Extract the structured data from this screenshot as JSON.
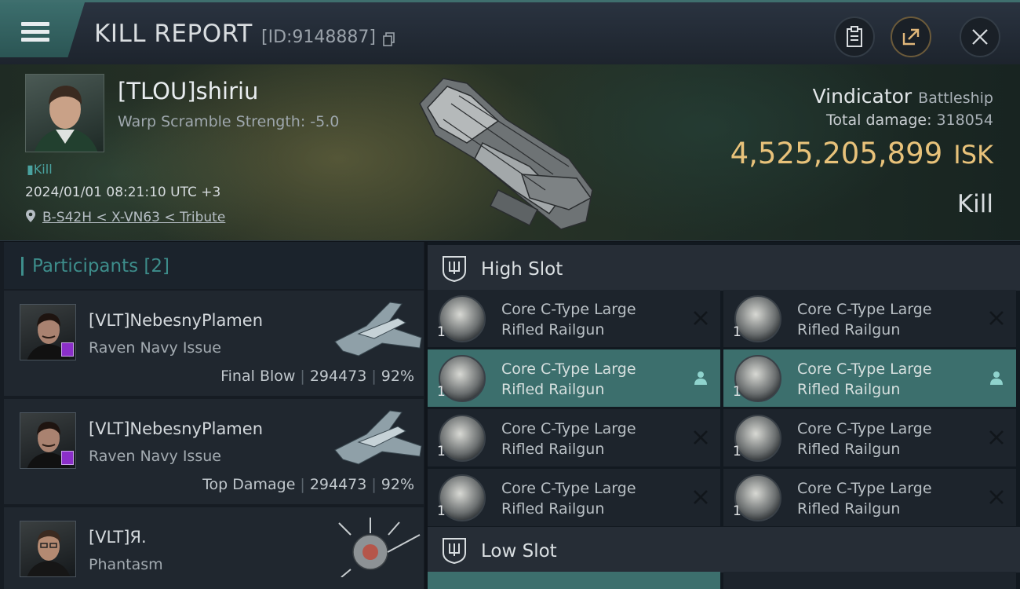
{
  "header": {
    "title": "KILL REPORT",
    "report_id": "[ID:9148887]",
    "icons": [
      "menu-icon",
      "copy-icon",
      "clipboard-icon",
      "share-icon",
      "close-icon"
    ]
  },
  "victim": {
    "name": "[TLOU]shiriu",
    "warp_scramble": "Warp Scramble Strength: -5.0",
    "tag": "Kill",
    "datetime": "2024/01/01 08:21:10 UTC +3",
    "location": "B-S42H < X-VN63 < Tribute"
  },
  "ship": {
    "name": "Vindicator",
    "class": "Battleship",
    "total_damage_label": "Total damage:",
    "total_damage_value": "318054",
    "isk_value": "4,525,205,899",
    "isk_currency": "ISK",
    "kill_label": "Kill"
  },
  "participants": {
    "title": "Participants",
    "count": "[2]",
    "items": [
      {
        "name": "[VLT]NebesnyPlamen",
        "ship": "Raven Navy Issue",
        "role": "Final Blow",
        "damage": "294473",
        "percent": "92%"
      },
      {
        "name": "[VLT]NebesnyPlamen",
        "ship": "Raven Navy Issue",
        "role": "Top Damage",
        "damage": "294473",
        "percent": "92%"
      },
      {
        "name": "[VLT]Я.",
        "ship": "Phantasm",
        "role": "",
        "damage": "",
        "percent": ""
      }
    ]
  },
  "fitting": {
    "high_slot": {
      "title": "High Slot",
      "modules": [
        {
          "name_line1": "Core C-Type Large",
          "name_line2": "Rifled Railgun",
          "qty": "1",
          "status": "destroyed"
        },
        {
          "name_line1": "Core C-Type Large",
          "name_line2": "Rifled Railgun",
          "qty": "1",
          "status": "destroyed"
        },
        {
          "name_line1": "Core C-Type Large",
          "name_line2": "Rifled Railgun",
          "qty": "1",
          "status": "dropped"
        },
        {
          "name_line1": "Core C-Type Large",
          "name_line2": "Rifled Railgun",
          "qty": "1",
          "status": "dropped"
        },
        {
          "name_line1": "Core C-Type Large",
          "name_line2": "Rifled Railgun",
          "qty": "1",
          "status": "destroyed"
        },
        {
          "name_line1": "Core C-Type Large",
          "name_line2": "Rifled Railgun",
          "qty": "1",
          "status": "destroyed"
        },
        {
          "name_line1": "Core C-Type Large",
          "name_line2": "Rifled Railgun",
          "qty": "1",
          "status": "destroyed"
        },
        {
          "name_line1": "Core C-Type Large",
          "name_line2": "Rifled Railgun",
          "qty": "1",
          "status": "destroyed"
        }
      ]
    },
    "low_slot": {
      "title": "Low Slot"
    }
  },
  "colors": {
    "accent": "#3c6f6d",
    "isk": "#e8c27a",
    "badge": "#8b2fc9"
  }
}
